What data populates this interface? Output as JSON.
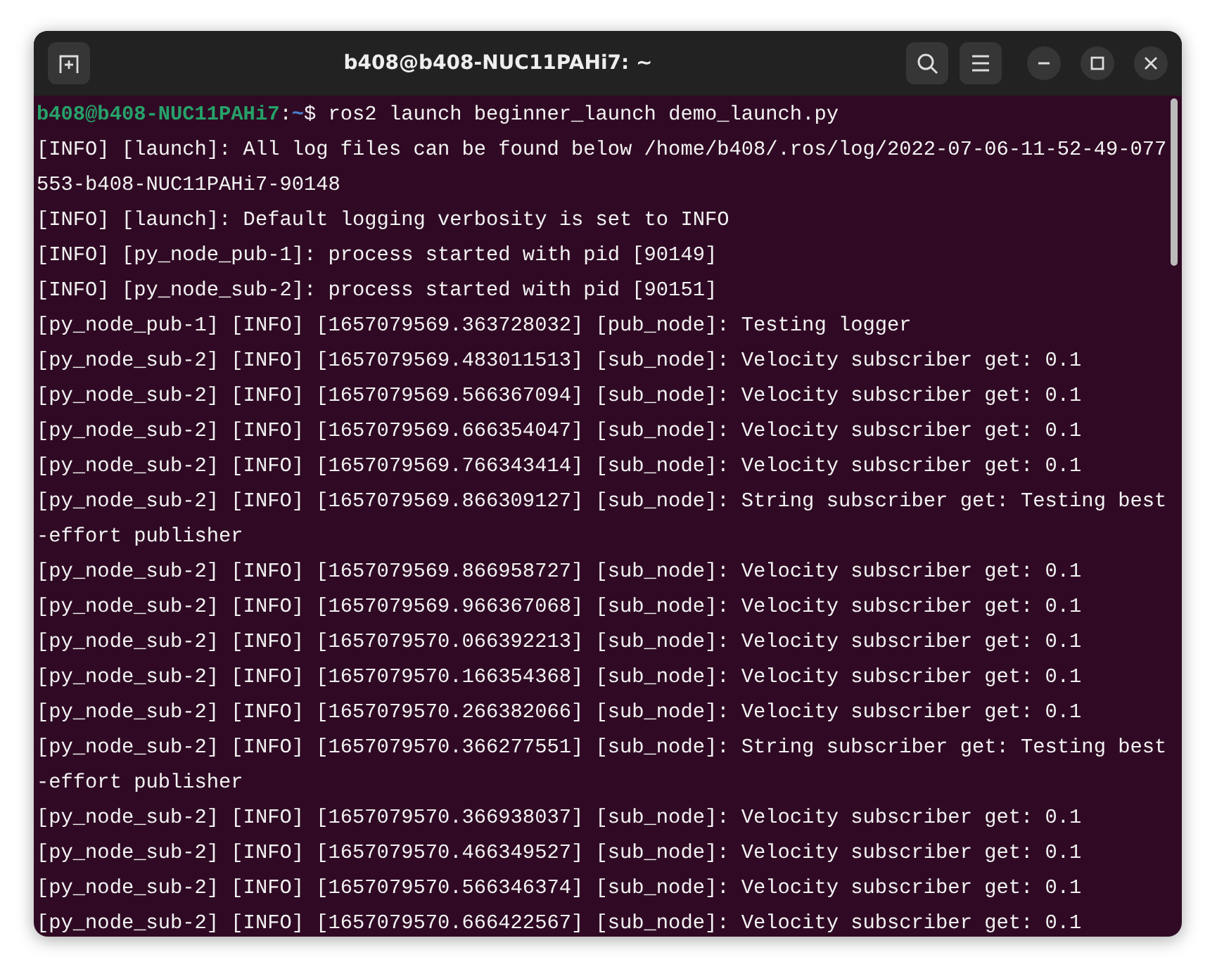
{
  "window": {
    "title": "b408@b408-NUC11PAHi7: ~"
  },
  "terminal": {
    "prompt": {
      "user_host": "b408@b408-NUC11PAHi7",
      "separator": ":",
      "path": "~",
      "symbol": "$",
      "command": " ros2 launch beginner_launch demo_launch.py"
    },
    "lines": [
      "[INFO] [launch]: All log files can be found below /home/b408/.ros/log/2022-07-06-11-52-49-077",
      "553-b408-NUC11PAHi7-90148",
      "[INFO] [launch]: Default logging verbosity is set to INFO",
      "[INFO] [py_node_pub-1]: process started with pid [90149]",
      "[INFO] [py_node_sub-2]: process started with pid [90151]",
      "[py_node_pub-1] [INFO] [1657079569.363728032] [pub_node]: Testing logger",
      "[py_node_sub-2] [INFO] [1657079569.483011513] [sub_node]: Velocity subscriber get: 0.1",
      "[py_node_sub-2] [INFO] [1657079569.566367094] [sub_node]: Velocity subscriber get: 0.1",
      "[py_node_sub-2] [INFO] [1657079569.666354047] [sub_node]: Velocity subscriber get: 0.1",
      "[py_node_sub-2] [INFO] [1657079569.766343414] [sub_node]: Velocity subscriber get: 0.1",
      "[py_node_sub-2] [INFO] [1657079569.866309127] [sub_node]: String subscriber get: Testing best",
      "-effort publisher",
      "[py_node_sub-2] [INFO] [1657079569.866958727] [sub_node]: Velocity subscriber get: 0.1",
      "[py_node_sub-2] [INFO] [1657079569.966367068] [sub_node]: Velocity subscriber get: 0.1",
      "[py_node_sub-2] [INFO] [1657079570.066392213] [sub_node]: Velocity subscriber get: 0.1",
      "[py_node_sub-2] [INFO] [1657079570.166354368] [sub_node]: Velocity subscriber get: 0.1",
      "[py_node_sub-2] [INFO] [1657079570.266382066] [sub_node]: Velocity subscriber get: 0.1",
      "[py_node_sub-2] [INFO] [1657079570.366277551] [sub_node]: String subscriber get: Testing best",
      "-effort publisher",
      "[py_node_sub-2] [INFO] [1657079570.366938037] [sub_node]: Velocity subscriber get: 0.1",
      "[py_node_sub-2] [INFO] [1657079570.466349527] [sub_node]: Velocity subscriber get: 0.1",
      "[py_node_sub-2] [INFO] [1657079570.566346374] [sub_node]: Velocity subscriber get: 0.1",
      "[py_node_sub-2] [INFO] [1657079570.666422567] [sub_node]: Velocity subscriber get: 0.1"
    ]
  }
}
